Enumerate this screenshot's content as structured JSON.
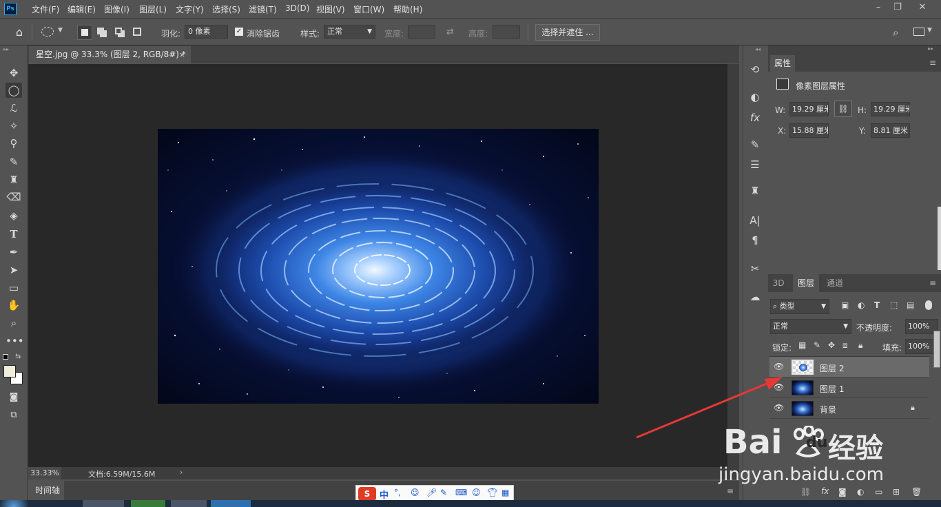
{
  "app": {
    "logo": "Ps"
  },
  "menu": [
    "文件(F)",
    "编辑(E)",
    "图像(I)",
    "图层(L)",
    "文字(Y)",
    "选择(S)",
    "滤镜(T)",
    "3D(D)",
    "视图(V)",
    "窗口(W)",
    "帮助(H)"
  ],
  "options": {
    "feather_label": "羽化:",
    "feather_value": "0 像素",
    "antialias_label": "消除锯齿",
    "style_label": "样式:",
    "style_value": "正常",
    "width_label": "宽度:",
    "height_label": "高度:",
    "select_mask_button": "选择并遮住 ..."
  },
  "document": {
    "tab_title": "星空.jpg @ 33.3% (图层 2, RGB/8#) *",
    "zoom": "33.33%",
    "doc_info": "文档:6.59M/15.6M",
    "timeline_label": "时间轴"
  },
  "properties": {
    "tab": "属性",
    "section": "像素图层属性",
    "w_label": "W:",
    "w_value": "19.29 厘米",
    "h_label": "H:",
    "h_value": "19.29 厘米",
    "x_label": "X:",
    "x_value": "15.88 厘米",
    "y_label": "Y:",
    "y_value": "8.81 厘米"
  },
  "layers_panel": {
    "tabs": [
      "3D",
      "图层",
      "通道"
    ],
    "filter_value": "类型",
    "blend_mode": "正常",
    "opacity_label": "不透明度:",
    "opacity_value": "100%",
    "lock_label": "锁定:",
    "fill_label": "填充:",
    "fill_value": "100%",
    "layers": [
      {
        "name": "图层 2",
        "selected": true
      },
      {
        "name": "图层 1",
        "selected": false
      },
      {
        "name": "背景",
        "selected": false,
        "locked": true
      }
    ]
  },
  "watermark": {
    "brand": "Bai",
    "brand2": "du",
    "brand3": "经验",
    "url": "jingyan.baidu.com"
  },
  "ime_bar": {
    "label": "中"
  },
  "colors": {
    "accent": "#31a8ff",
    "panel_bg": "#535353",
    "canvas_bg": "#282828",
    "arrow": "#e53935"
  }
}
